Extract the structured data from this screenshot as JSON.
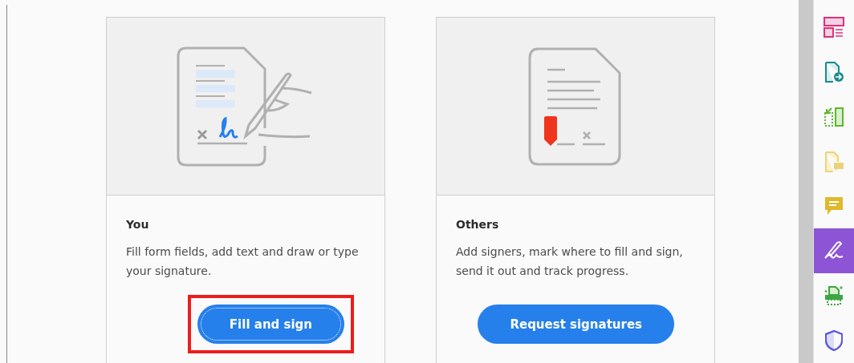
{
  "cards": [
    {
      "kind": "self",
      "title": "You",
      "description": "Fill form fields, add text and draw or type your signature.",
      "button": "Fill and sign",
      "highlighted": true
    },
    {
      "kind": "others",
      "title": "Others",
      "description": "Add signers, mark where to fill and sign, send it out and track progress.",
      "button": "Request signatures",
      "highlighted": false
    }
  ],
  "tools": [
    {
      "kind": "organize",
      "selected": false
    },
    {
      "kind": "export",
      "selected": false
    },
    {
      "kind": "compress",
      "selected": false
    },
    {
      "kind": "notes",
      "selected": false
    },
    {
      "kind": "comment",
      "selected": false
    },
    {
      "kind": "sign",
      "selected": true
    },
    {
      "kind": "scan",
      "selected": false
    },
    {
      "kind": "protect",
      "selected": false
    }
  ]
}
